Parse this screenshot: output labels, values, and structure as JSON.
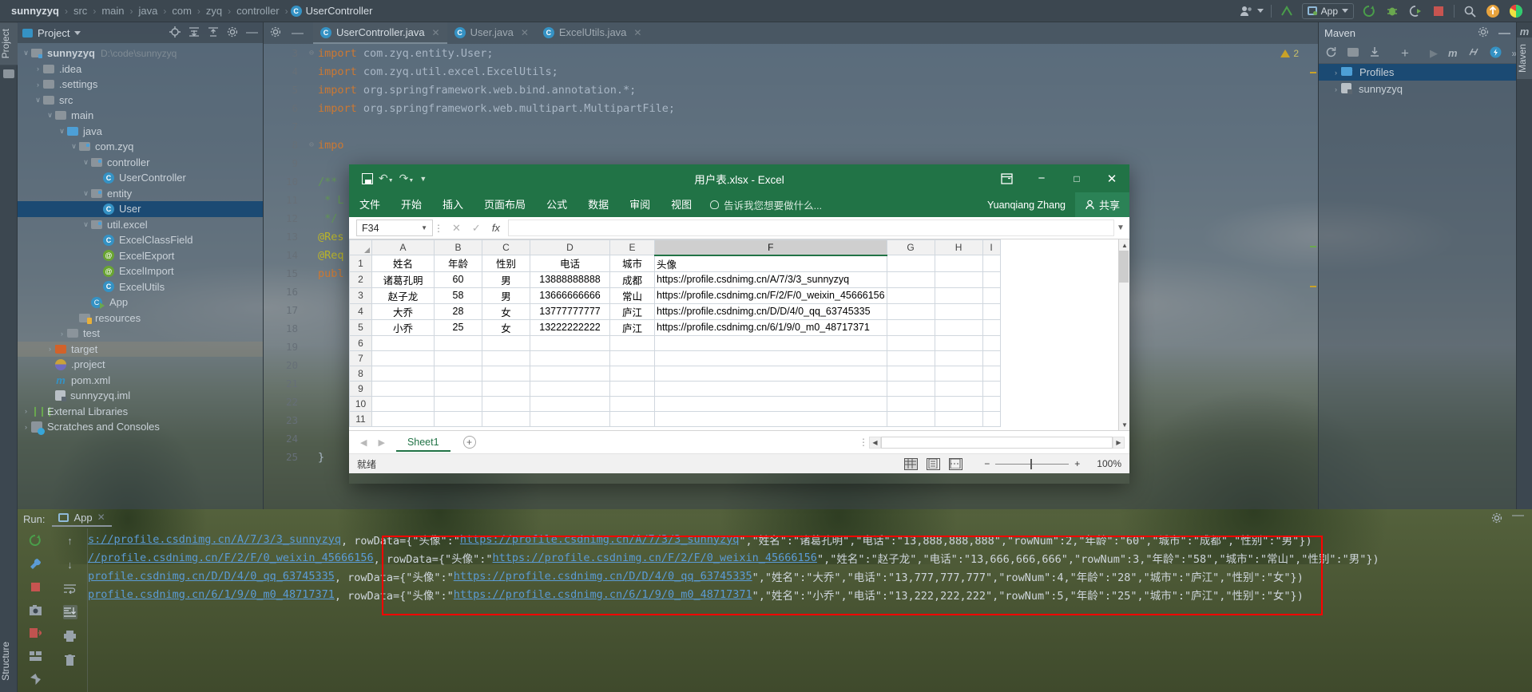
{
  "breadcrumb": {
    "items": [
      "sunnyzyq",
      "src",
      "main",
      "java",
      "com",
      "zyq",
      "controller"
    ],
    "class_name": "UserController",
    "separator": "›"
  },
  "toolbar": {
    "run_config_label": "App",
    "icons": [
      "people-icon",
      "update-project-icon",
      "run-icon",
      "debug-icon",
      "run-coverage-icon",
      "stop-icon",
      "search-icon",
      "upload-icon",
      "idea-icon"
    ]
  },
  "left_strip": {
    "project_label": "Project",
    "structure_label": "Structure"
  },
  "project_panel": {
    "title": "Project",
    "header_icons": [
      "locate-icon",
      "expand-all-icon",
      "collapse-all-icon",
      "settings-icon",
      "hide-icon"
    ],
    "tree": [
      {
        "label": "sunnyzyq",
        "path": "D:\\code\\sunnyzyq",
        "indent": 0,
        "arrow": "∨",
        "icon": "module-folder",
        "bold": true
      },
      {
        "label": ".idea",
        "indent": 1,
        "arrow": "›",
        "icon": "folder"
      },
      {
        "label": ".settings",
        "indent": 1,
        "arrow": "›",
        "icon": "folder"
      },
      {
        "label": "src",
        "indent": 1,
        "arrow": "∨",
        "icon": "folder"
      },
      {
        "label": "main",
        "indent": 2,
        "arrow": "∨",
        "icon": "folder"
      },
      {
        "label": "java",
        "indent": 3,
        "arrow": "∨",
        "icon": "folder-blue"
      },
      {
        "label": "com.zyq",
        "indent": 4,
        "arrow": "∨",
        "icon": "package"
      },
      {
        "label": "controller",
        "indent": 5,
        "arrow": "∨",
        "icon": "package"
      },
      {
        "label": "UserController",
        "indent": 6,
        "arrow": "",
        "icon": "class"
      },
      {
        "label": "entity",
        "indent": 5,
        "arrow": "∨",
        "icon": "package"
      },
      {
        "label": "User",
        "indent": 6,
        "arrow": "",
        "icon": "class",
        "selected": true
      },
      {
        "label": "util.excel",
        "indent": 5,
        "arrow": "∨",
        "icon": "package"
      },
      {
        "label": "ExcelClassField",
        "indent": 6,
        "arrow": "",
        "icon": "class"
      },
      {
        "label": "ExcelExport",
        "indent": 6,
        "arrow": "",
        "icon": "annotation"
      },
      {
        "label": "ExcelImport",
        "indent": 6,
        "arrow": "",
        "icon": "annotation"
      },
      {
        "label": "ExcelUtils",
        "indent": 6,
        "arrow": "",
        "icon": "class"
      },
      {
        "label": "App",
        "indent": 5,
        "arrow": "",
        "icon": "runnable-class"
      },
      {
        "label": "resources",
        "indent": 4,
        "arrow": "",
        "icon": "resources-folder"
      },
      {
        "label": "test",
        "indent": 3,
        "arrow": "›",
        "icon": "folder"
      },
      {
        "label": "target",
        "indent": 2,
        "arrow": "›",
        "icon": "folder-orange",
        "highlighted": true
      },
      {
        "label": ".project",
        "indent": 2,
        "arrow": "",
        "icon": "project-file"
      },
      {
        "label": "pom.xml",
        "indent": 2,
        "arrow": "",
        "icon": "maven-file"
      },
      {
        "label": "sunnyzyq.iml",
        "indent": 2,
        "arrow": "",
        "icon": "iml-file"
      },
      {
        "label": "External Libraries",
        "indent": 0,
        "arrow": "›",
        "icon": "library"
      },
      {
        "label": "Scratches and Consoles",
        "indent": 0,
        "arrow": "›",
        "icon": "scratch"
      }
    ]
  },
  "editor": {
    "tabs": [
      {
        "label": "UserController.java",
        "active": true
      },
      {
        "label": "User.java",
        "active": false
      },
      {
        "label": "ExcelUtils.java",
        "active": false
      }
    ],
    "warning_count": "2",
    "lines": [
      {
        "num": "3",
        "fold": "⊖",
        "text": "import com.zyq.entity.User;",
        "kw": "import"
      },
      {
        "num": "4",
        "fold": "",
        "text": "import com.zyq.util.excel.ExcelUtils;",
        "kw": "import"
      },
      {
        "num": "5",
        "fold": "",
        "text": "import org.springframework.web.bind.annotation.*;",
        "kw": "import"
      },
      {
        "num": "6",
        "fold": "",
        "text": "import org.springframework.web.multipart.MultipartFile;",
        "kw": "import"
      },
      {
        "num": "7",
        "fold": "",
        "text": "",
        "kw": ""
      },
      {
        "num": "8",
        "fold": "⊖",
        "text": "impo",
        "kw": "impo"
      },
      {
        "num": "9",
        "fold": "",
        "text": "",
        "kw": ""
      },
      {
        "num": "10",
        "fold": "",
        "text": "/**",
        "kw": ""
      },
      {
        "num": "11",
        "fold": "",
        "text": " * L",
        "kw": ""
      },
      {
        "num": "12",
        "fold": "",
        "text": " */",
        "kw": ""
      },
      {
        "num": "13",
        "fold": "",
        "text": "@Res",
        "kw": "@Res"
      },
      {
        "num": "14",
        "fold": "",
        "text": "@Req",
        "kw": "@Req"
      },
      {
        "num": "15",
        "fold": "",
        "text": "publ",
        "kw": "publ"
      },
      {
        "num": "16",
        "fold": "",
        "text": "",
        "kw": ""
      },
      {
        "num": "17",
        "fold": "",
        "text": "",
        "kw": ""
      },
      {
        "num": "18",
        "fold": "",
        "text": "",
        "kw": ""
      },
      {
        "num": "19",
        "fold": "",
        "text": "",
        "kw": ""
      },
      {
        "num": "20",
        "fold": "",
        "text": "",
        "kw": ""
      },
      {
        "num": "21",
        "fold": "",
        "text": "",
        "kw": ""
      },
      {
        "num": "22",
        "fold": "",
        "text": "",
        "kw": ""
      },
      {
        "num": "23",
        "fold": "",
        "text": "",
        "kw": ""
      },
      {
        "num": "24",
        "fold": "",
        "text": "",
        "kw": ""
      },
      {
        "num": "25",
        "fold": "",
        "text": "}",
        "kw": ""
      }
    ]
  },
  "maven": {
    "title": "Maven",
    "toolbar_icons": [
      "reload-icon",
      "add-folder-icon",
      "download-sources-icon",
      "add-icon",
      "run-icon",
      "maven-icon",
      "skip-tests-icon",
      "execute-icon",
      "more-icon"
    ],
    "items": [
      {
        "label": "Profiles",
        "selected": true,
        "arrow": "›"
      },
      {
        "label": "sunnyzyq",
        "selected": false,
        "arrow": "›"
      }
    ],
    "side_label": "Maven"
  },
  "excel": {
    "title": "用户表.xlsx - Excel",
    "quick_access": [
      "save-icon",
      "undo-icon",
      "redo-icon",
      "customize-icon"
    ],
    "window_buttons": [
      "ribbon-display-options-icon",
      "minimize-icon",
      "maximize-icon",
      "close-icon"
    ],
    "ribbon_tabs": [
      "文件",
      "开始",
      "插入",
      "页面布局",
      "公式",
      "数据",
      "审阅",
      "视图"
    ],
    "tell_me": "告诉我您想要做什么...",
    "user_name": "Yuanqiang Zhang",
    "share_label": "共享",
    "name_box": "F34",
    "formula_value": "",
    "formula_buttons": [
      "cancel-icon",
      "enter-icon",
      "insert-function-icon"
    ],
    "columns": [
      "A",
      "B",
      "C",
      "D",
      "E",
      "F",
      "G",
      "H",
      "I"
    ],
    "selected_column": "F",
    "rows": [
      "1",
      "2",
      "3",
      "4",
      "5",
      "6",
      "7",
      "8",
      "9",
      "10",
      "11"
    ],
    "data": [
      [
        "姓名",
        "年龄",
        "性别",
        "电话",
        "城市",
        "头像",
        "",
        "",
        ""
      ],
      [
        "诸葛孔明",
        "60",
        "男",
        "13888888888",
        "成都",
        "https://profile.csdnimg.cn/A/7/3/3_sunnyzyq",
        "",
        "",
        ""
      ],
      [
        "赵子龙",
        "58",
        "男",
        "13666666666",
        "常山",
        "https://profile.csdnimg.cn/F/2/F/0_weixin_45666156",
        "",
        "",
        ""
      ],
      [
        "大乔",
        "28",
        "女",
        "13777777777",
        "庐江",
        "https://profile.csdnimg.cn/D/D/4/0_qq_63745335",
        "",
        "",
        ""
      ],
      [
        "小乔",
        "25",
        "女",
        "13222222222",
        "庐江",
        "https://profile.csdnimg.cn/6/1/9/0_m0_48717371",
        "",
        "",
        ""
      ],
      [
        "",
        "",
        "",
        "",
        "",
        "",
        "",
        "",
        ""
      ],
      [
        "",
        "",
        "",
        "",
        "",
        "",
        "",
        "",
        ""
      ],
      [
        "",
        "",
        "",
        "",
        "",
        "",
        "",
        "",
        ""
      ],
      [
        "",
        "",
        "",
        "",
        "",
        "",
        "",
        "",
        ""
      ],
      [
        "",
        "",
        "",
        "",
        "",
        "",
        "",
        "",
        ""
      ],
      [
        "",
        "",
        "",
        "",
        "",
        "",
        "",
        "",
        ""
      ]
    ],
    "sheet_tab": "Sheet1",
    "add_sheet_label": "+",
    "status_text": "就绪",
    "zoom_level": "100%",
    "view_buttons": [
      "normal-view-icon",
      "page-layout-icon",
      "page-break-icon"
    ]
  },
  "run": {
    "label": "Run:",
    "config_name": "App",
    "tool_icons_left": [
      "rerun-icon",
      "settings-wrench-icon",
      "stop-icon",
      "camera-icon",
      "export-icon",
      "layout-icon",
      "pin-icon"
    ],
    "tool_icons_right": [
      "up-icon",
      "down-icon",
      "soft-wrap-icon",
      "scroll-to-end-icon",
      "print-icon",
      "trash-icon"
    ],
    "console_lines": [
      {
        "prefix_link": "s://profile.csdnimg.cn/A/7/3/3_sunnyzyq",
        "middle": ", rowData={\"头像\":\"",
        "link": "https://profile.csdnimg.cn/A/7/3/3_sunnyzyq",
        "suffix": "\",\"姓名\":\"诸葛孔明\",\"电话\":\"13,888,888,888\",\"rowNum\":2,\"年龄\":\"60\",\"城市\":\"成都\",\"性别\":\"男\"})"
      },
      {
        "prefix_link": "//profile.csdnimg.cn/F/2/F/0_weixin_45666156",
        "middle": ", rowData={\"头像\":\"",
        "link": "https://profile.csdnimg.cn/F/2/F/0_weixin_45666156",
        "suffix": "\",\"姓名\":\"赵子龙\",\"电话\":\"13,666,666,666\",\"rowNum\":3,\"年龄\":\"58\",\"城市\":\"常山\",\"性别\":\"男\"})"
      },
      {
        "prefix_link": "profile.csdnimg.cn/D/D/4/0_qq_63745335",
        "middle": ", rowData={\"头像\":\"",
        "link": "https://profile.csdnimg.cn/D/D/4/0_qq_63745335",
        "suffix": "\",\"姓名\":\"大乔\",\"电话\":\"13,777,777,777\",\"rowNum\":4,\"年龄\":\"28\",\"城市\":\"庐江\",\"性别\":\"女\"})"
      },
      {
        "prefix_link": "profile.csdnimg.cn/6/1/9/0_m0_48717371",
        "middle": ", rowData={\"头像\":\"",
        "link": "https://profile.csdnimg.cn/6/1/9/0_m0_48717371",
        "suffix": "\",\"姓名\":\"小乔\",\"电话\":\"13,222,222,222\",\"rowNum\":5,\"年龄\":\"25\",\"城市\":\"庐江\",\"性别\":\"女\"})"
      }
    ],
    "highlight_color": "#ff0000"
  }
}
